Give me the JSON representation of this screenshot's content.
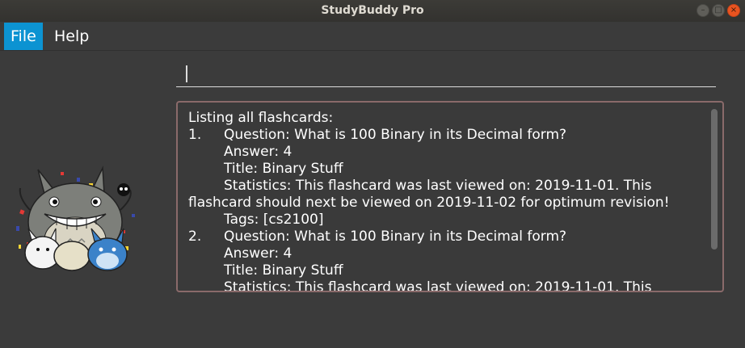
{
  "window": {
    "title": "StudyBuddy Pro",
    "controls": {
      "minimize": "–",
      "maximize": "□",
      "close": "×"
    }
  },
  "menu": {
    "items": [
      "File",
      "Help"
    ]
  },
  "command": {
    "value": "",
    "placeholder": ""
  },
  "result": {
    "header": "Listing all flashcards:",
    "cards": [
      {
        "number": "1.",
        "question": "Question: What is 100 Binary in its Decimal form?",
        "answer": "Answer: 4",
        "title": "Title: Binary Stuff",
        "stats_line1": "Statistics: This flashcard was last viewed on: 2019-11-01. This",
        "stats_line2": "flashcard should next be viewed on 2019-11-02 for optimum revision!",
        "tags": "Tags: [cs2100]"
      },
      {
        "number": "2.",
        "question": "Question: What is 100 Binary in its Decimal form?",
        "answer": "Answer: 4",
        "title": "Title: Binary Stuff",
        "stats_line1": "Statistics: This flashcard was last viewed on: 2019-11-01. This"
      }
    ]
  },
  "colors": {
    "background": "#3b3b3b",
    "menu_active": "#0c93d2",
    "result_border": "#8a6a6a",
    "close_button": "#e95420"
  }
}
